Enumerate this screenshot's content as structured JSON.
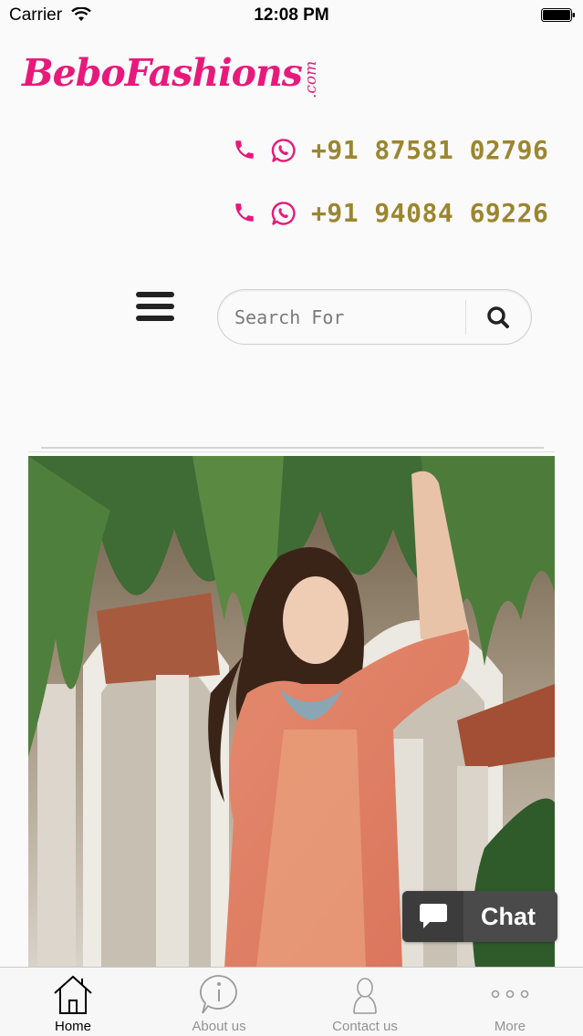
{
  "status_bar": {
    "carrier": "Carrier",
    "time": "12:08 PM"
  },
  "logo": {
    "text": "BeboFashions",
    "suffix": ".com"
  },
  "contacts": [
    {
      "number": "+91 87581 02796"
    },
    {
      "number": "+91 94084 69226"
    }
  ],
  "search": {
    "placeholder": "Search For"
  },
  "chat": {
    "label": "Chat"
  },
  "tabs": [
    {
      "label": "Home",
      "icon": "home-icon",
      "active": true
    },
    {
      "label": "About us",
      "icon": "info-icon",
      "active": false
    },
    {
      "label": "Contact us",
      "icon": "contact-icon",
      "active": false
    },
    {
      "label": "More",
      "icon": "more-icon",
      "active": false
    }
  ],
  "colors": {
    "brand_pink": "#e8197b",
    "phone_gold": "#9b8630",
    "chat_bg": "#4a4a4a"
  }
}
